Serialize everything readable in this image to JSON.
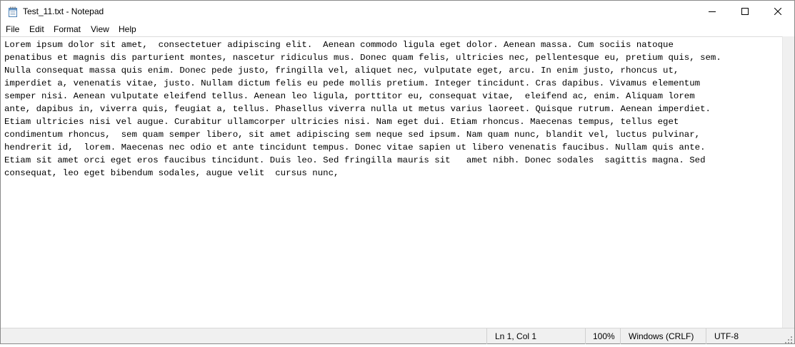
{
  "window": {
    "title": "Test_11.txt - Notepad"
  },
  "icons": {
    "app": "notepad-icon",
    "minimize": "minimize-icon",
    "maximize": "maximize-icon",
    "close": "close-icon",
    "grip": "resize-grip-icon"
  },
  "menu": {
    "items": [
      "File",
      "Edit",
      "Format",
      "View",
      "Help"
    ]
  },
  "editor": {
    "lines": [
      "Lorem ipsum dolor sit amet,  consectetuer adipiscing elit.  Aenean commodo ligula eget dolor. Aenean massa. Cum sociis natoque",
      "penatibus et magnis dis parturient montes, nascetur ridiculus mus. Donec quam felis, ultricies nec, pellentesque eu, pretium quis, sem.",
      "Nulla consequat massa quis enim. Donec pede justo, fringilla vel, aliquet nec, vulputate eget, arcu. In enim justo, rhoncus ut,",
      "imperdiet a, venenatis vitae, justo. Nullam dictum felis eu pede mollis pretium. Integer tincidunt. Cras dapibus. Vivamus elementum",
      "semper nisi. Aenean vulputate eleifend tellus. Aenean leo ligula, porttitor eu, consequat vitae,  eleifend ac, enim. Aliquam lorem",
      "ante, dapibus in, viverra quis, feugiat a, tellus. Phasellus viverra nulla ut metus varius laoreet. Quisque rutrum. Aenean imperdiet.",
      "Etiam ultricies nisi vel augue. Curabitur ullamcorper ultricies nisi. Nam eget dui. Etiam rhoncus. Maecenas tempus, tellus eget",
      "condimentum rhoncus,  sem quam semper libero, sit amet adipiscing sem neque sed ipsum. Nam quam nunc, blandit vel, luctus pulvinar,",
      "hendrerit id,  lorem. Maecenas nec odio et ante tincidunt tempus. Donec vitae sapien ut libero venenatis faucibus. Nullam quis ante.",
      "Etiam sit amet orci eget eros faucibus tincidunt. Duis leo. Sed fringilla mauris sit   amet nibh. Donec sodales  sagittis magna. Sed",
      "consequat, leo eget bibendum sodales, augue velit  cursus nunc,"
    ]
  },
  "status": {
    "position": "Ln 1, Col 1",
    "zoom": "100%",
    "line_ending": "Windows (CRLF)",
    "encoding": "UTF-8"
  }
}
